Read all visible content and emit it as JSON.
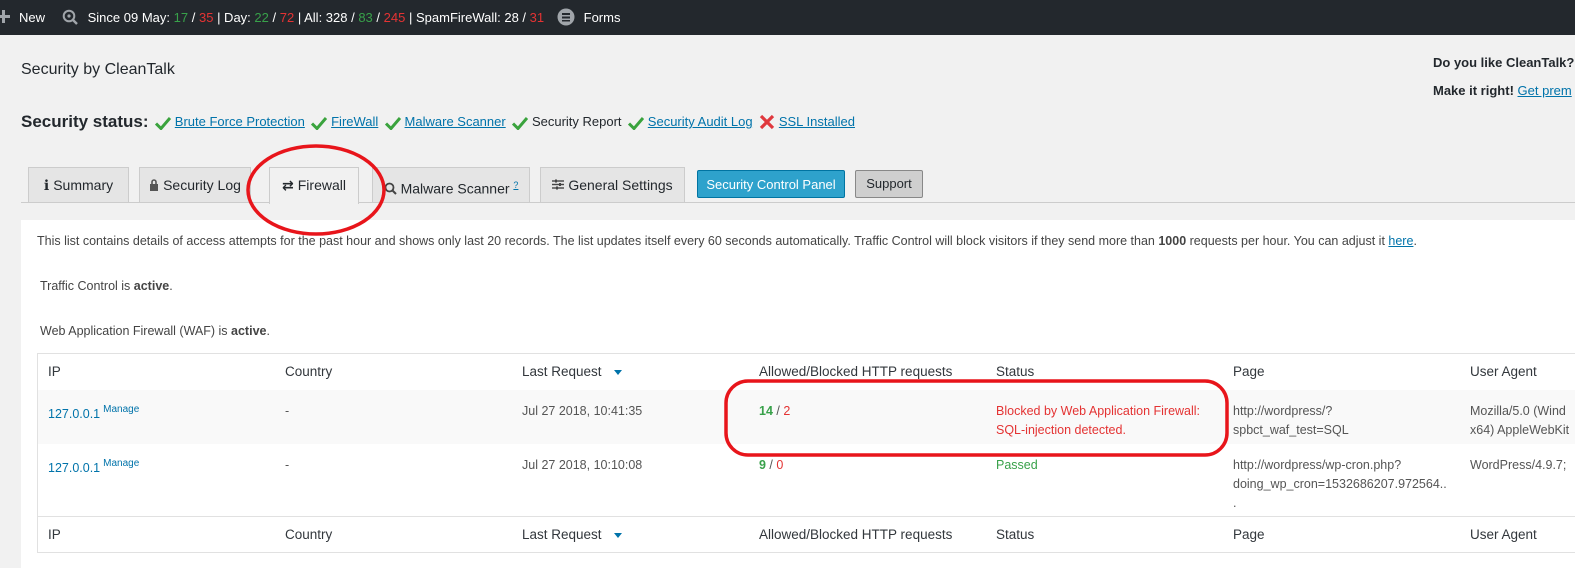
{
  "adminbar": {
    "new_label": "New",
    "since_label": "Since 09 May:",
    "since_allowed": "17",
    "since_blocked": "35",
    "day_label": "| Day:",
    "day_allowed": "22",
    "day_blocked": "72",
    "all_label": "| All: 328 /",
    "all_allowed": "83",
    "all_blocked": "245",
    "spam_label": "| SpamFireWall: 28 /",
    "spam_blocked": "31",
    "forms_label": "Forms",
    "sep": "/"
  },
  "header": {
    "title": "Security by CleanTalk",
    "like_text": "Do you like CleanTalk?",
    "make_right": "Make it right!",
    "get_premium": "Get prem"
  },
  "security_status": {
    "label": "Security status:",
    "items": [
      {
        "label": "Brute Force Protection",
        "ok": true,
        "link": true
      },
      {
        "label": "FireWall",
        "ok": true,
        "link": true
      },
      {
        "label": "Malware Scanner",
        "ok": true,
        "link": true
      },
      {
        "label": "Security Report",
        "ok": true,
        "link": false
      },
      {
        "label": "Security Audit Log",
        "ok": true,
        "link": true
      },
      {
        "label": "SSL Installed",
        "ok": false,
        "link": true
      }
    ]
  },
  "tabs": [
    {
      "label": "Summary",
      "icon": "info-icon"
    },
    {
      "label": "Security Log",
      "icon": "lock-icon"
    },
    {
      "label": "Firewall",
      "icon": "arrows-exchange-icon"
    },
    {
      "label": "Malware Scanner",
      "icon": "search-icon",
      "sup": "?"
    },
    {
      "label": "General Settings",
      "icon": "sliders-icon"
    }
  ],
  "buttons": {
    "control_panel": "Security Control Panel",
    "support": "Support"
  },
  "firewall": {
    "intro_a": "This list contains details of access attempts for the past hour and shows only last 20 records. The list updates itself every 60 seconds automatically. Traffic Control will block visitors if they send more than ",
    "intro_limit": "1000",
    "intro_b": " requests per hour. You can adjust it ",
    "intro_link": "here",
    "intro_end": ".",
    "traffic_control_text": "Traffic Control is ",
    "traffic_control_state": "active",
    "waf_text": "Web Application Firewall (WAF) is ",
    "waf_state": "active",
    "period": "."
  },
  "table": {
    "columns": [
      "IP",
      "Country",
      "Last Request",
      "Allowed/Blocked HTTP requests",
      "Status",
      "Page",
      "User Agent"
    ],
    "rows": [
      {
        "ip": "127.0.0.1",
        "manage": "Manage",
        "country": "-",
        "last_request": "Jul 27 2018, 10:41:35",
        "allowed": "14",
        "blocked": "2",
        "status_line1": "Blocked by Web Application Firewall:",
        "status_line2": "SQL-injection detected.",
        "page_line1": "http://wordpress/?",
        "page_line2": "spbct_waf_test=SQL",
        "ua_line1": "Mozilla/5.0 (Wind",
        "ua_line2": "x64) AppleWebKit"
      },
      {
        "ip": "127.0.0.1",
        "manage": "Manage",
        "country": "-",
        "last_request": "Jul 27 2018, 10:10:08",
        "allowed": "9",
        "blocked": "0",
        "status_line1": "Passed",
        "page_line1": "http://wordpress/wp-cron.php?",
        "page_line2": "doing_wp_cron=1532686207.972564..",
        "page_line3": ".",
        "ua_line1": "WordPress/4.9.7;"
      }
    ],
    "slash": " / "
  },
  "colors": {
    "adminbar_bg": "#23282d",
    "allowed_green": "#38a14a",
    "blocked_red": "#e43333",
    "link_blue": "#0073aa",
    "primary_button": "#2ea2cc",
    "annotation_red": "#e8151b"
  }
}
